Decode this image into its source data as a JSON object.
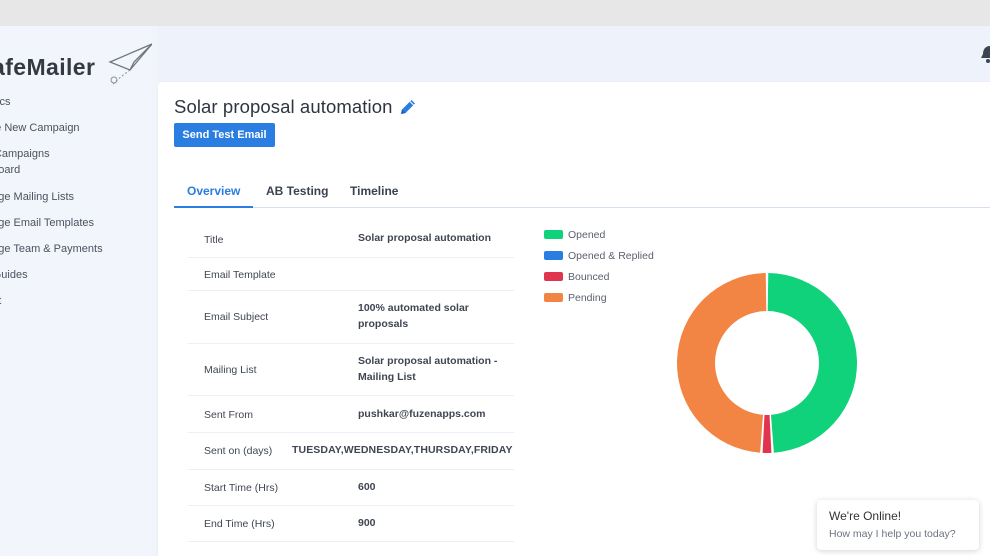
{
  "app": {
    "logo_text": "afeMailer"
  },
  "sidebar": {
    "items": [
      {
        "label": "lytics"
      },
      {
        "label": "ate New Campaign"
      },
      {
        "label": "il Campaigns"
      },
      {
        "label": "hboard"
      },
      {
        "label": "nage Mailing Lists"
      },
      {
        "label": "nage Email Templates"
      },
      {
        "label": "nage Team & Payments"
      },
      {
        "label": "r Guides"
      },
      {
        "label": "out"
      }
    ]
  },
  "page": {
    "title": "Solar proposal automation",
    "send_test_label": "Send Test Email"
  },
  "tabs": [
    {
      "label": "Overview",
      "active": true
    },
    {
      "label": "AB Testing",
      "active": false
    },
    {
      "label": "Timeline",
      "active": false
    }
  ],
  "details": [
    {
      "label": "Title",
      "value": "Solar proposal automation"
    },
    {
      "label": "Email Template",
      "value": ""
    },
    {
      "label": "Email Subject",
      "value": "100% automated solar proposals"
    },
    {
      "label": "Mailing List",
      "value": "Solar proposal automation - Mailing List"
    },
    {
      "label": "Sent From",
      "value": "pushkar@fuzenapps.com"
    },
    {
      "label": "Sent on (days)",
      "value": "TUESDAY,WEDNESDAY,THURSDAY,FRIDAY"
    },
    {
      "label": "Start Time (Hrs)",
      "value": "600"
    },
    {
      "label": "End Time (Hrs)",
      "value": "900"
    }
  ],
  "colors": {
    "accent": "#2a7de1",
    "opened": "#0fd27a",
    "opened_replied": "#2a7de1",
    "bounced": "#e0344f",
    "pending": "#f28444"
  },
  "chart_data": {
    "type": "pie",
    "variant": "donut",
    "legend": "top-left",
    "categories": [
      "Opened",
      "Opened & Replied",
      "Bounced",
      "Pending"
    ],
    "values": [
      49,
      0,
      2,
      49
    ],
    "colors": [
      "#0fd27a",
      "#2a7de1",
      "#e0344f",
      "#f28444"
    ]
  },
  "chat": {
    "title": "We're Online!",
    "subtitle": "How may I help you today?"
  }
}
